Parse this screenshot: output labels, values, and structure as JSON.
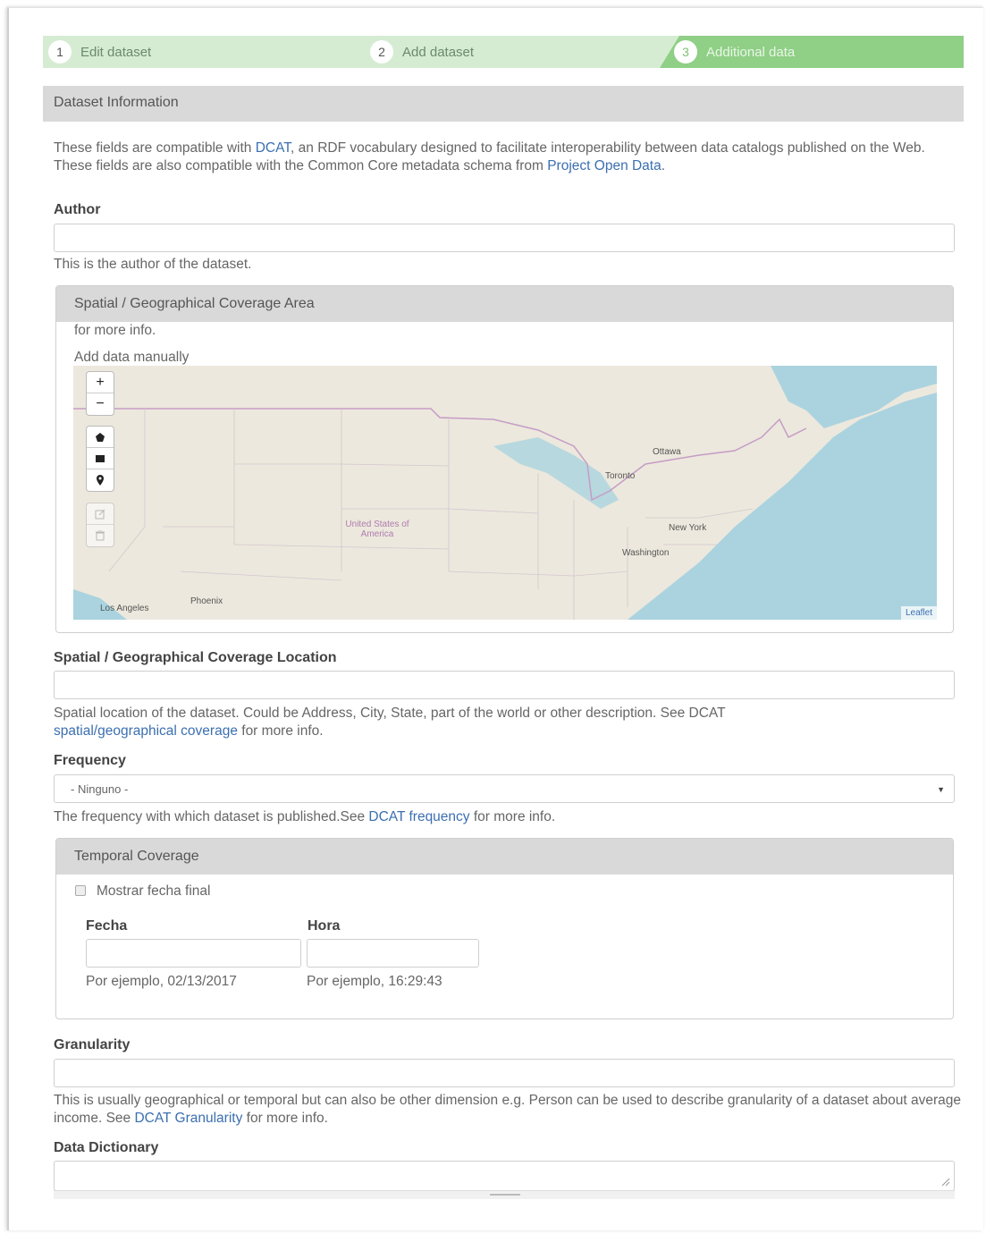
{
  "stepper": [
    {
      "num": "1",
      "label": "Edit dataset"
    },
    {
      "num": "2",
      "label": "Add dataset"
    },
    {
      "num": "3",
      "label": "Additional data"
    }
  ],
  "section": {
    "title": "Dataset Information"
  },
  "intro": {
    "part1": "These fields are compatible with ",
    "link1": "DCAT",
    "part2": ", an RDF vocabulary designed to facilitate interoperability between data catalogs published on the Web. These fields are also compatible with the Common Core metadata schema from ",
    "link2": "Project Open Data",
    "part3": "."
  },
  "author": {
    "label": "Author",
    "help": "This is the author of the dataset.",
    "value": ""
  },
  "spatial_area": {
    "title": "Spatial / Geographical Coverage Area",
    "note": "for more info.",
    "manual": "Add data manually",
    "map": {
      "zoom_in": "+",
      "zoom_out": "−",
      "cities": [
        "Ottawa",
        "Toronto",
        "New York",
        "Washington",
        "Los Angeles",
        "Phoenix"
      ],
      "country": "United States of America",
      "attribution": "Leaflet"
    }
  },
  "spatial_location": {
    "label": "Spatial / Geographical Coverage Location",
    "value": "",
    "help1": "Spatial location of the dataset. Could be Address, City, State, part of the world or other description. See DCAT",
    "help_link": "spatial/geographical coverage",
    "help2": " for more info."
  },
  "frequency": {
    "label": "Frequency",
    "selected": "- Ninguno -",
    "help1": "The frequency with which dataset is published.See ",
    "help_link": "DCAT frequency",
    "help2": " for more info."
  },
  "temporal": {
    "title": "Temporal Coverage",
    "checkbox_label": "Mostrar fecha final",
    "date_label": "Fecha",
    "time_label": "Hora",
    "date_example": "Por ejemplo, 02/13/2017",
    "time_example": "Por ejemplo, 16:29:43"
  },
  "granularity": {
    "label": "Granularity",
    "help1": "This is usually geographical or temporal but can also be other dimension e.g. Person can be used to describe granularity of a dataset about average income. See ",
    "help_link": "DCAT Granularity",
    "help2": " for more info."
  },
  "data_dictionary": {
    "label": "Data Dictionary"
  },
  "colors": {
    "link": "#3b6fb0",
    "step_active": "#8fcf86",
    "step_inactive": "#d5ecd2",
    "header_bg": "#d9d9d9"
  }
}
